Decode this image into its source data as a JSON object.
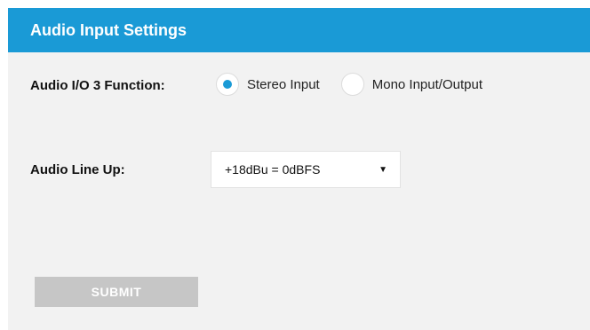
{
  "panel": {
    "title": "Audio Input Settings"
  },
  "audio_io3": {
    "label": "Audio I/O 3 Function:",
    "options": [
      {
        "label": "Stereo Input",
        "selected": true
      },
      {
        "label": "Mono Input/Output",
        "selected": false
      }
    ]
  },
  "line_up": {
    "label": "Audio Line Up:",
    "selected": "+18dBu = 0dBFS",
    "arrow_icon": "triangle-down"
  },
  "actions": {
    "submit_label": "SUBMIT"
  },
  "colors": {
    "header": "#1a9ad6",
    "panel_bg": "#f2f2f2",
    "radio_accent": "#1a9ad6",
    "submit_disabled": "#c6c6c6"
  }
}
